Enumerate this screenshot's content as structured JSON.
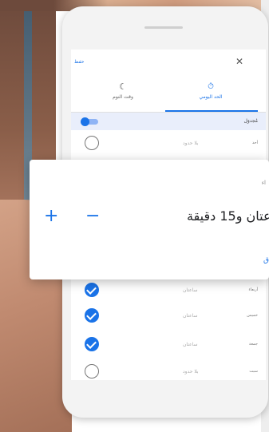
{
  "colors": {
    "accent": "#1a73e8",
    "selected_row_bg": "#e9eefb",
    "text_primary": "#202124"
  },
  "header": {
    "save_label": "حفظ",
    "close_icon": "close-icon"
  },
  "tabs": [
    {
      "label": "الحد اليومي",
      "icon": "timer-icon",
      "glyph": "⏱",
      "selected": true
    },
    {
      "label": "وقت النوم",
      "icon": "moon-icon",
      "glyph": "☾",
      "selected": false
    }
  ],
  "schedule": {
    "label": "مُجدوَل",
    "enabled": true
  },
  "days": [
    {
      "name": "أحد",
      "value": "بلا حدود",
      "checked": false
    },
    {
      "name": "أربعاء",
      "value": "ساعتان",
      "checked": true
    },
    {
      "name": "خميس",
      "value": "ساعتان",
      "checked": true
    },
    {
      "name": "جمعة",
      "value": "ساعتان",
      "checked": true
    },
    {
      "name": "سبت",
      "value": "بلا حدود",
      "checked": false
    }
  ],
  "dialog": {
    "label": "اء",
    "duration": "عتان و15 دقيقة",
    "minus": "−",
    "plus": "+",
    "link": "ق"
  }
}
